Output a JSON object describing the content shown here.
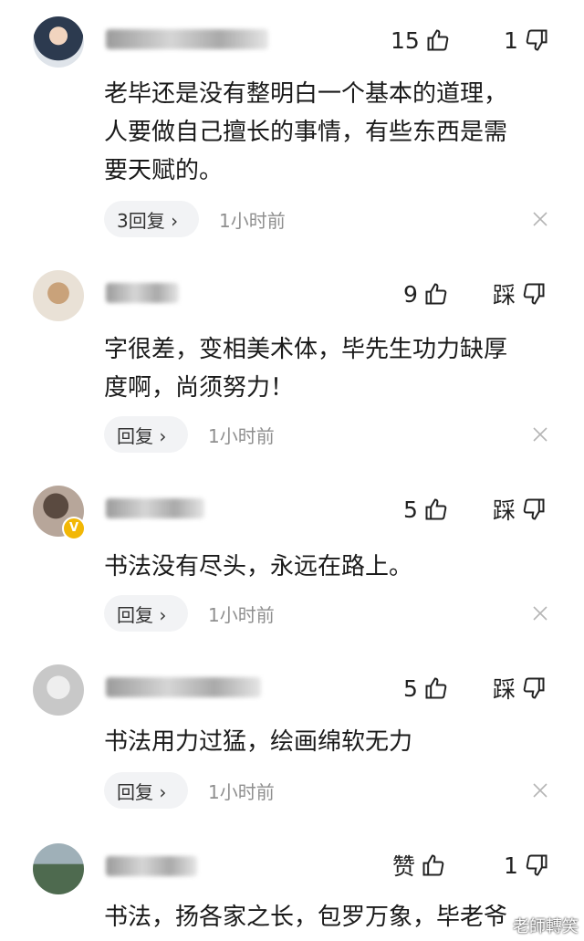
{
  "comments": [
    {
      "likes": "15",
      "right_label": "1",
      "text_lines": [
        "老毕还是没有整明白一个基本的道理，",
        "人要做自己擅长的事情，有些东西是需",
        "要天赋的。"
      ],
      "reply": "3回复 ›",
      "time": "1小时前"
    },
    {
      "likes": "9",
      "right_label": "踩",
      "text_lines": [
        "字很差，变相美术体，毕先生功力缺厚",
        "度啊，尚须努力！"
      ],
      "reply": "回复 ›",
      "time": "1小时前"
    },
    {
      "likes": "5",
      "right_label": "踩",
      "text_lines": [
        "书法没有尽头，永远在路上。"
      ],
      "reply": "回复 ›",
      "time": "1小时前",
      "badge": "V"
    },
    {
      "likes": "5",
      "right_label": "踩",
      "text_lines": [
        "书法用力过猛，绘画绵软无力"
      ],
      "reply": "回复 ›",
      "time": "1小时前"
    },
    {
      "likes": "赞",
      "right_label": "1",
      "text_lines": [
        "书法，扬各家之长，包罗万象，毕老爷"
      ],
      "reply": "",
      "time": ""
    }
  ],
  "watermark": "老師轉笑"
}
